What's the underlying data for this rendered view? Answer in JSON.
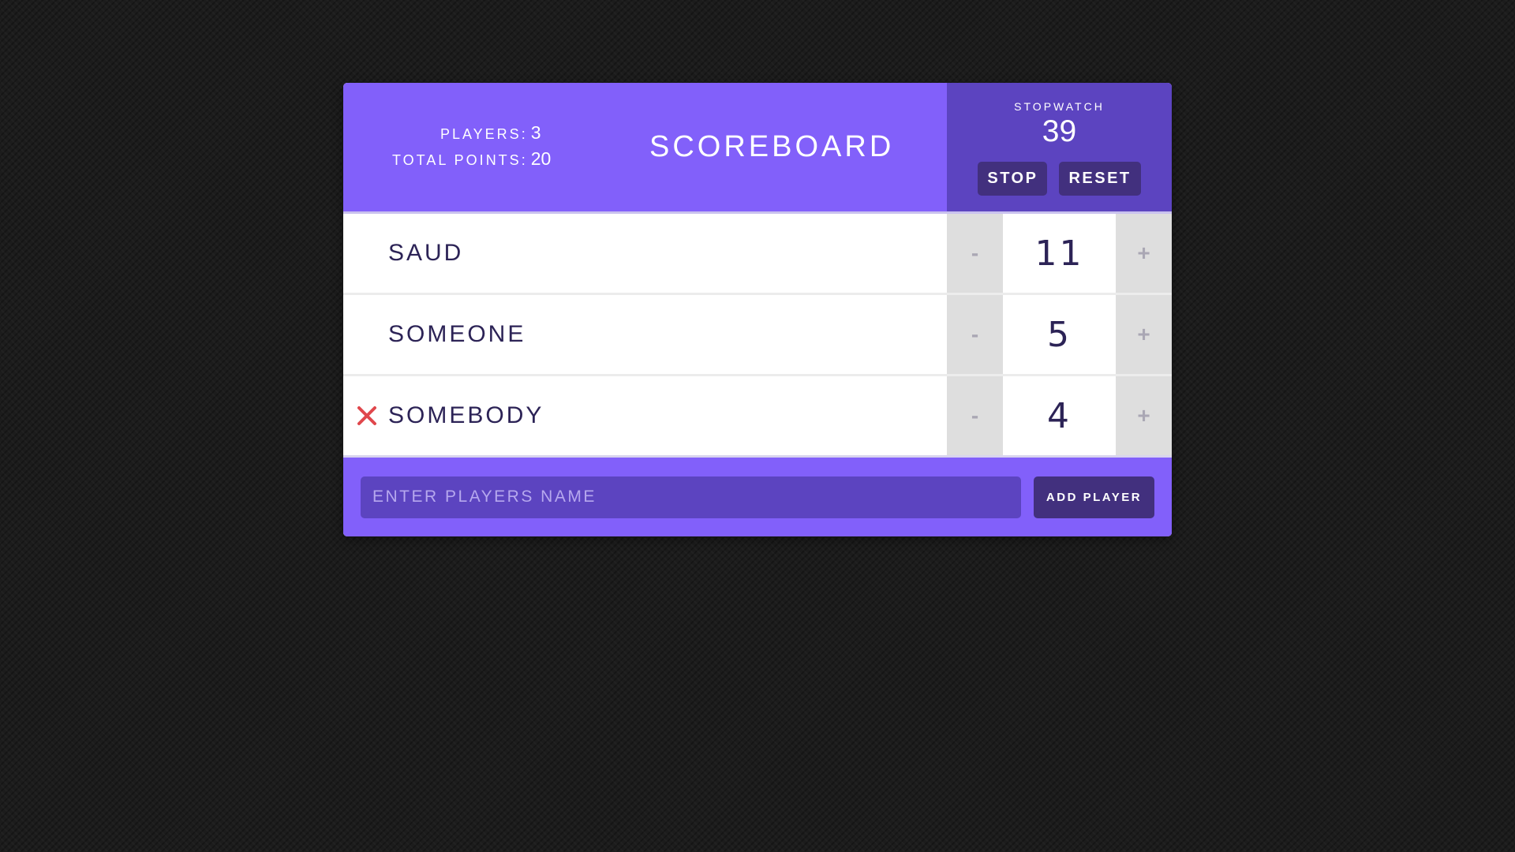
{
  "header": {
    "players_label": "PLAYERS:",
    "players_count": "3",
    "points_label": "TOTAL POINTS:",
    "points_total": "20",
    "title": "SCOREBOARD"
  },
  "stopwatch": {
    "label": "STOPWATCH",
    "time": "39",
    "stop_label": "STOP",
    "reset_label": "RESET"
  },
  "players": [
    {
      "name": "SAUD",
      "score": "11",
      "decrement_label": "-",
      "increment_label": "+",
      "remove_icon_visible": false
    },
    {
      "name": "SOMEONE",
      "score": "5",
      "decrement_label": "-",
      "increment_label": "+",
      "remove_icon_visible": false
    },
    {
      "name": "SOMEBODY",
      "score": "4",
      "decrement_label": "-",
      "increment_label": "+",
      "remove_icon_visible": true
    }
  ],
  "add_player": {
    "placeholder": "ENTER PLAYERS NAME",
    "value": "",
    "button_label": "ADD PLAYER"
  },
  "icons": {
    "remove": "close-icon"
  },
  "colors": {
    "accent": "#8260fa",
    "accent_dark": "#5c44c0",
    "button_dark": "#42307e",
    "text_dark": "#2c2356",
    "remove": "#e0474c"
  }
}
